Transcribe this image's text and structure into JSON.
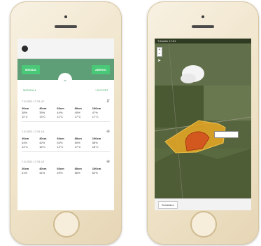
{
  "left_phone": {
    "app": {
      "header_icon": "settings-gear-icon",
      "buttons": {
        "left": "MEDIDA",
        "right": "ABRIGO"
      },
      "toggle_icon": "chevron-down-icon",
      "controls": {
        "filter": "MEDIDA ▾",
        "export": "\\ EXPORT"
      },
      "blocks": [
        {
          "title": "7.8.2021 17:51:47",
          "icon": "filter-icon",
          "headers": [
            "20cm",
            "40cm",
            "60cm",
            "80cm",
            "100cm"
          ],
          "row1": [
            "38%",
            "35%",
            "44%",
            "40%",
            "47%"
          ],
          "row2": [
            "11°C",
            "13°C",
            "11°C",
            "17°C",
            "17°C"
          ]
        },
        {
          "title": "7.8.2021 17:51:16",
          "icon": "plus-icon",
          "headers": [
            "20cm",
            "40cm",
            "60cm",
            "80cm",
            "100cm"
          ],
          "row1": [
            "34%",
            "42%",
            "53%",
            "50%",
            "58%"
          ],
          "row2": [
            "14°C",
            "16°C",
            "12°C",
            "17°C",
            "18°C"
          ]
        },
        {
          "title": "7.8.2021 17:51:15",
          "icon": "plus-icon",
          "headers": [
            "20cm",
            "40cm",
            "60cm",
            "80cm",
            "100cm"
          ],
          "row1": [
            "31%",
            "41%",
            "49%",
            "56%",
            "62%"
          ],
          "row2": []
        }
      ]
    }
  },
  "right_phone": {
    "status": "T-Mobile  17:51",
    "zoom": [
      "+",
      "−"
    ],
    "bottom_button": "Schließen",
    "colors": {
      "field": "#e9a825",
      "zone": "#d24b1d",
      "outline": "#f0c24a"
    }
  }
}
